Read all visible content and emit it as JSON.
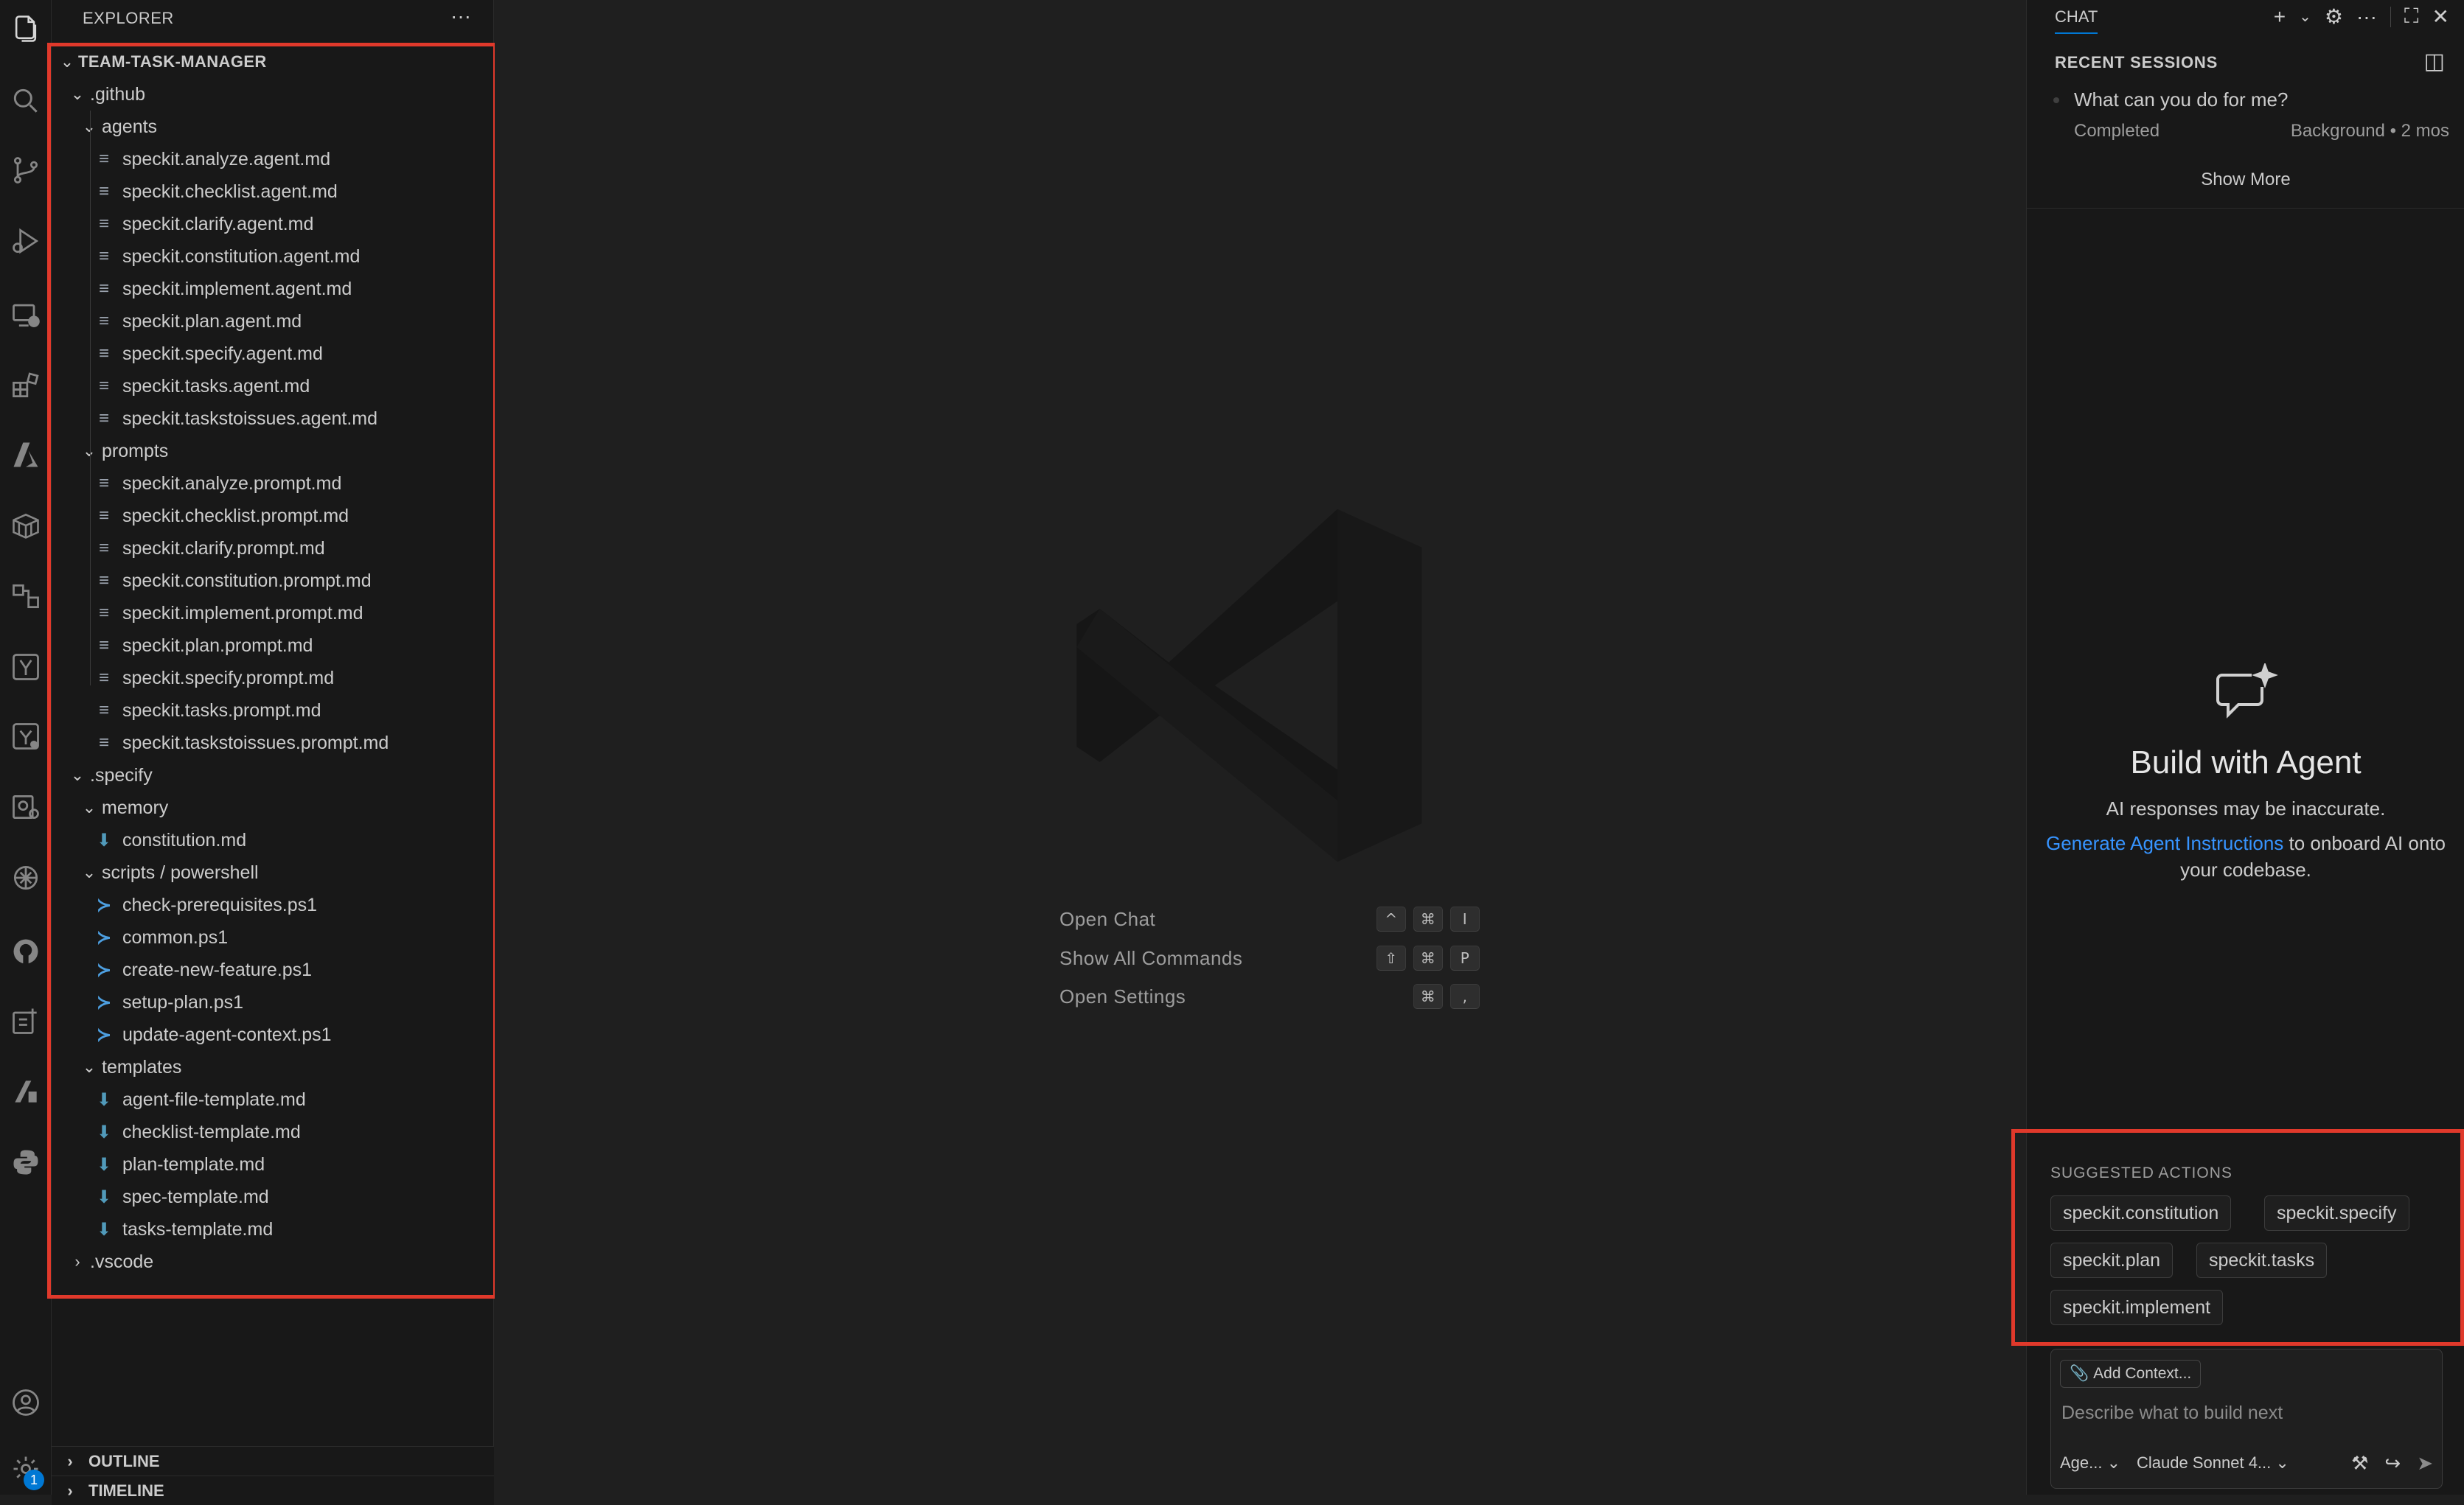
{
  "activity_bar": {
    "icons": [
      "files-icon",
      "search-icon",
      "source-control-icon",
      "run-debug-icon",
      "remote-explorer-icon",
      "extensions-icon",
      "azure-icon",
      "containers-icon",
      "live-share-icon",
      "testing-icon",
      "github-actions-icon",
      "accounts-ext-icon",
      "openai-icon",
      "github-icon",
      "project-manager-icon",
      "azure-ai-icon",
      "python-icon"
    ],
    "bottom_icons": [
      "accounts-icon",
      "manage-icon"
    ],
    "manage_badge": "1"
  },
  "explorer": {
    "header": "EXPLORER",
    "more": "···",
    "root": "TEAM-TASK-MANAGER",
    "tree": [
      {
        "depth": 1,
        "kind": "folder",
        "open": true,
        "label": ".github"
      },
      {
        "depth": 2,
        "kind": "folder",
        "open": true,
        "label": "agents"
      },
      {
        "depth": 3,
        "kind": "md",
        "label": "speckit.analyze.agent.md"
      },
      {
        "depth": 3,
        "kind": "md",
        "label": "speckit.checklist.agent.md"
      },
      {
        "depth": 3,
        "kind": "md",
        "label": "speckit.clarify.agent.md"
      },
      {
        "depth": 3,
        "kind": "md",
        "label": "speckit.constitution.agent.md"
      },
      {
        "depth": 3,
        "kind": "md",
        "label": "speckit.implement.agent.md"
      },
      {
        "depth": 3,
        "kind": "md",
        "label": "speckit.plan.agent.md"
      },
      {
        "depth": 3,
        "kind": "md",
        "label": "speckit.specify.agent.md"
      },
      {
        "depth": 3,
        "kind": "md",
        "label": "speckit.tasks.agent.md"
      },
      {
        "depth": 3,
        "kind": "md",
        "label": "speckit.taskstoissues.agent.md"
      },
      {
        "depth": 2,
        "kind": "folder",
        "open": true,
        "label": "prompts"
      },
      {
        "depth": 3,
        "kind": "md",
        "label": "speckit.analyze.prompt.md"
      },
      {
        "depth": 3,
        "kind": "md",
        "label": "speckit.checklist.prompt.md"
      },
      {
        "depth": 3,
        "kind": "md",
        "label": "speckit.clarify.prompt.md"
      },
      {
        "depth": 3,
        "kind": "md",
        "label": "speckit.constitution.prompt.md"
      },
      {
        "depth": 3,
        "kind": "md",
        "label": "speckit.implement.prompt.md"
      },
      {
        "depth": 3,
        "kind": "md",
        "label": "speckit.plan.prompt.md"
      },
      {
        "depth": 3,
        "kind": "md",
        "label": "speckit.specify.prompt.md"
      },
      {
        "depth": 3,
        "kind": "md",
        "label": "speckit.tasks.prompt.md"
      },
      {
        "depth": 3,
        "kind": "md",
        "label": "speckit.taskstoissues.prompt.md"
      },
      {
        "depth": 1,
        "kind": "folder",
        "open": true,
        "label": ".specify"
      },
      {
        "depth": 2,
        "kind": "folder",
        "open": true,
        "label": "memory"
      },
      {
        "depth": 3,
        "kind": "mdblue",
        "label": "constitution.md"
      },
      {
        "depth": 2,
        "kind": "folder",
        "open": true,
        "label": "scripts / powershell"
      },
      {
        "depth": 3,
        "kind": "ps",
        "label": "check-prerequisites.ps1"
      },
      {
        "depth": 3,
        "kind": "ps",
        "label": "common.ps1"
      },
      {
        "depth": 3,
        "kind": "ps",
        "label": "create-new-feature.ps1"
      },
      {
        "depth": 3,
        "kind": "ps",
        "label": "setup-plan.ps1"
      },
      {
        "depth": 3,
        "kind": "ps",
        "label": "update-agent-context.ps1"
      },
      {
        "depth": 2,
        "kind": "folder",
        "open": true,
        "label": "templates"
      },
      {
        "depth": 3,
        "kind": "mdblue",
        "label": "agent-file-template.md"
      },
      {
        "depth": 3,
        "kind": "mdblue",
        "label": "checklist-template.md"
      },
      {
        "depth": 3,
        "kind": "mdblue",
        "label": "plan-template.md"
      },
      {
        "depth": 3,
        "kind": "mdblue",
        "label": "spec-template.md"
      },
      {
        "depth": 3,
        "kind": "mdblue",
        "label": "tasks-template.md"
      },
      {
        "depth": 1,
        "kind": "folder",
        "open": false,
        "label": ".vscode"
      }
    ],
    "sections": [
      "OUTLINE",
      "TIMELINE"
    ]
  },
  "editor": {
    "shortcuts": [
      {
        "label": "Open Chat",
        "keys": [
          "^",
          "⌘",
          "I"
        ]
      },
      {
        "label": "Show All Commands",
        "keys": [
          "⇧",
          "⌘",
          "P"
        ]
      },
      {
        "label": "Open Settings",
        "keys": [
          "⌘",
          ","
        ]
      }
    ]
  },
  "chat": {
    "tab": "CHAT",
    "recent_title": "RECENT SESSIONS",
    "session": {
      "title": "What can you do for me?",
      "status": "Completed",
      "meta": "Background • 2 mos"
    },
    "show_more": "Show More",
    "empty_title": "Build with Agent",
    "empty_sub": "AI responses may be inaccurate.",
    "gen_link": "Generate Agent Instructions",
    "gen_rest": " to onboard AI onto your codebase.",
    "suggested_title": "SUGGESTED ACTIONS",
    "suggested": [
      "speckit.constitution",
      "speckit.specify",
      "speckit.plan",
      "speckit.tasks",
      "speckit.implement"
    ],
    "add_context": "Add Context...",
    "input_placeholder": "Describe what to build next",
    "mode": "Age...",
    "model": "Claude Sonnet 4..."
  },
  "colors": {
    "highlight": "#e0392b",
    "link": "#3794ff",
    "accent": "#0078d4"
  }
}
